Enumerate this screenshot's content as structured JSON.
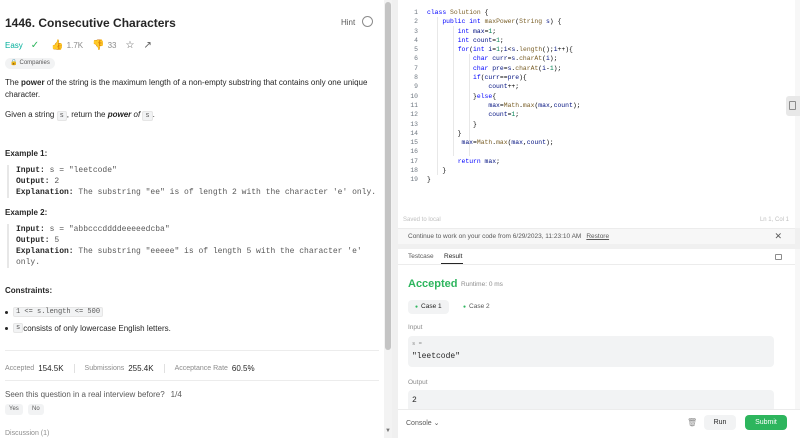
{
  "problem": {
    "title": "1446. Consecutive Characters",
    "hint_label": "Hint",
    "difficulty": "Easy",
    "likes": "1.7K",
    "dislikes": "33",
    "companies_label": "Companies",
    "desc_1a": "The ",
    "desc_1b": "power",
    "desc_1c": " of the string is the maximum length of a non-empty substring that contains only one unique character.",
    "desc_2a": "Given a string ",
    "desc_2b": "s",
    "desc_2c": ", return the ",
    "desc_2d": "power",
    "desc_2e": " of ",
    "desc_2f": "s",
    "desc_2g": ".",
    "examples": [
      {
        "title": "Example 1:",
        "input_label": "Input:",
        "input": "s = \"leetcode\"",
        "output_label": "Output:",
        "output": "2",
        "explanation_label": "Explanation:",
        "explanation": "The substring \"ee\" is of length 2 with the character 'e' only."
      },
      {
        "title": "Example 2:",
        "input_label": "Input:",
        "input": "s = \"abbcccddddeeeeedcba\"",
        "output_label": "Output:",
        "output": "5",
        "explanation_label": "Explanation:",
        "explanation": "The substring \"eeeee\" is of length 5 with the character 'e' only."
      }
    ],
    "constraints_title": "Constraints:",
    "constraint_1": "1 <= s.length <= 500",
    "constraint_2a": "s",
    "constraint_2b": " consists of only lowercase English letters.",
    "stats": {
      "accepted_label": "Accepted",
      "accepted": "154.5K",
      "submissions_label": "Submissions",
      "submissions": "255.4K",
      "rate_label": "Acceptance Rate",
      "rate": "60.5%"
    },
    "interview_question": "Seen this question in a real interview before?",
    "interview_fraction": "1/4",
    "yes_label": "Yes",
    "no_label": "No",
    "discussion_cut": "Discussion (1)"
  },
  "editor": {
    "line_numbers": [
      "1",
      "2",
      "3",
      "4",
      "5",
      "6",
      "7",
      "8",
      "9",
      "10",
      "11",
      "12",
      "13",
      "14",
      "15",
      "16",
      "17",
      "18",
      "19"
    ],
    "saved_label": "Saved to local",
    "cursor_label": "Ln 1, Col 1",
    "restore_text": "Continue to work on your code from 6/29/2023, 11:23:10 AM",
    "restore_label": "Restore"
  },
  "result": {
    "tab_testcase": "Testcase",
    "tab_result": "Result",
    "status": "Accepted",
    "runtime": "Runtime: 0 ms",
    "case_1": "Case 1",
    "case_2": "Case 2",
    "input_label": "Input",
    "input_var": "s =",
    "input_value": "\"leetcode\"",
    "output_label": "Output",
    "output_value": "2"
  },
  "footer": {
    "console_label": "Console",
    "run_label": "Run",
    "submit_label": "Submit"
  },
  "colors": {
    "easy": "#00af9b",
    "accepted": "#2db55d",
    "submit": "#2db55d"
  }
}
